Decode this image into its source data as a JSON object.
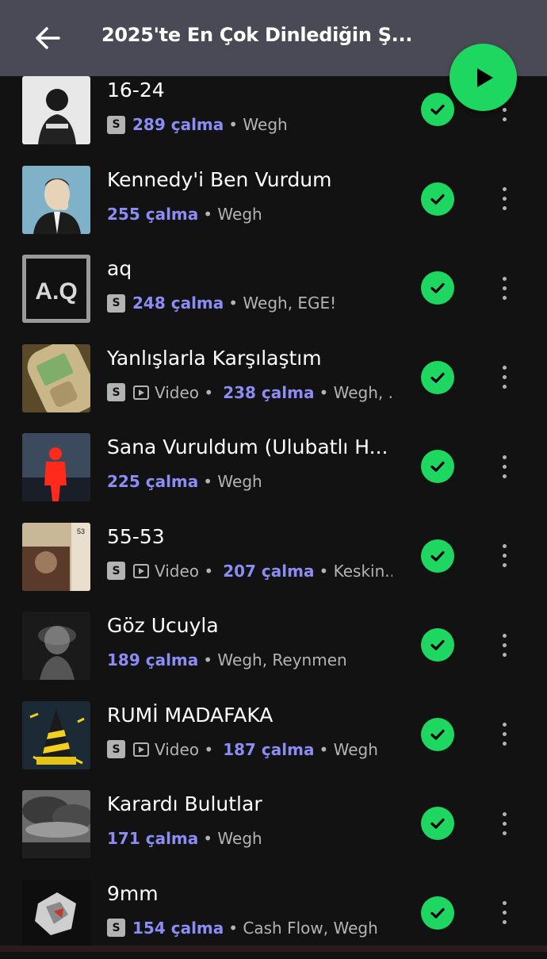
{
  "header": {
    "title": "2025'te En Çok Dinlediğin Ş..."
  },
  "tracks": [
    {
      "title": "16-24",
      "explicit": true,
      "video": false,
      "plays": "289 çalma",
      "artists": "• Wegh",
      "art": "portrait-bw"
    },
    {
      "title": "Kennedy'i Ben Vurdum",
      "explicit": false,
      "video": false,
      "plays": "255 çalma",
      "artists": "• Wegh",
      "art": "kennedy-illustration"
    },
    {
      "title": "aq",
      "explicit": true,
      "video": false,
      "plays": "248 çalma",
      "artists": "• Wegh, EGE!",
      "art": "aq-text",
      "art_text": "A.Q"
    },
    {
      "title": "Yanlışlarla Karşılaştım",
      "explicit": true,
      "video": true,
      "video_label": "Video •",
      "plays": "238 çalma",
      "artists": "• Wegh, ...",
      "art": "nokia-phone"
    },
    {
      "title": "Sana Vuruldum (Ulubatlı H...",
      "explicit": false,
      "video": false,
      "plays": "225 çalma",
      "artists": "• Wegh",
      "art": "red-figure"
    },
    {
      "title": "55-53",
      "explicit": true,
      "video": true,
      "video_label": "Video •",
      "plays": "207 çalma",
      "artists": "• Keskin...",
      "art": "film-collage"
    },
    {
      "title": "Göz Ucuyla",
      "explicit": false,
      "video": false,
      "plays": "189 çalma",
      "artists": "• Wegh, Reynmen",
      "art": "smoke-face"
    },
    {
      "title": "RUMİ MADAFAKA",
      "explicit": true,
      "video": true,
      "video_label": "Video •",
      "plays": "187 çalma",
      "artists": "• Wegh",
      "art": "yellow-tower"
    },
    {
      "title": "Karardı Bulutlar",
      "explicit": false,
      "video": false,
      "plays": "171 çalma",
      "artists": "• Wegh",
      "art": "storm-clouds"
    },
    {
      "title": "9mm",
      "explicit": true,
      "video": false,
      "plays": "154 çalma",
      "artists": "• Cash Flow, Wegh",
      "art": "crumpled-foil"
    }
  ],
  "colors": {
    "accent": "#1ed760",
    "plays": "#8c8cf5",
    "header_bg": "#4a4a56",
    "bg": "#121212"
  }
}
